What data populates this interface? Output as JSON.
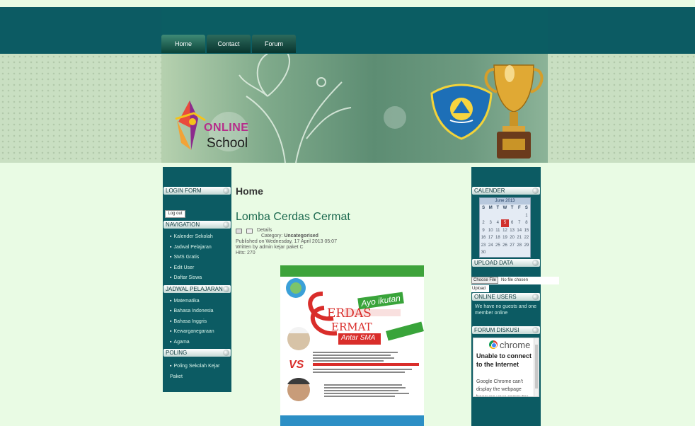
{
  "nav": {
    "tabs": [
      "Home",
      "Contact",
      "Forum"
    ]
  },
  "logo": {
    "online": "ONLINE",
    "school": "School"
  },
  "left": {
    "login": {
      "header": "LOGIN FORM",
      "logout": "Log out"
    },
    "navigation": {
      "header": "NAVIGATION",
      "items": [
        "Kalender Sekolah",
        "Jadwal Pelajaran",
        "SMS Gratis",
        "Edit User",
        "Daftar Siswa"
      ]
    },
    "jadwal": {
      "header": "JADWAL PELAJARAN",
      "items": [
        "Matematika",
        "Bahasa Indonesia",
        "Bahasa Inggris",
        "Kewarganegaraan",
        "Agama"
      ]
    },
    "poling": {
      "header": "POLING",
      "items": [
        "Poling Sekolah Kejar Paket"
      ]
    }
  },
  "main": {
    "page_title": "Home",
    "article_title": "Lomba Cerdas Cermat",
    "details": "Details",
    "category_label": "Category:",
    "category": "Uncategorised",
    "published": "Published on Wednesday, 17 April 2013 05:07",
    "written": "Written by admin kejar paket C",
    "hits": "Hits: 270"
  },
  "poster": {
    "ayo": "Ayo ikutan",
    "cerdas": "ERDAS",
    "cermat": "ERMAT",
    "antar": "Antar SMA",
    "vs": "VS"
  },
  "right": {
    "calendar": {
      "header": "CALENDER",
      "month": "June 2013",
      "days": [
        "S",
        "M",
        "T",
        "W",
        "T",
        "F",
        "S"
      ],
      "today": 5
    },
    "upload": {
      "header": "UPLOAD DATA",
      "choose": "Choose File",
      "nofile": "No file chosen",
      "upload": "Upload"
    },
    "online_users": {
      "header": "ONLINE USERS",
      "text": "We have no guests and one member online"
    },
    "forum": {
      "header": "FORUM DISKUSI",
      "chrome_word": "chrome",
      "title": "Unable to connect to the Internet",
      "body": "Google Chrome can't display the webpage because your computer isn't connected to the Internet."
    }
  },
  "colors": {
    "teal": "#0c5b63",
    "page_bg": "#e9fbe4",
    "link_green": "#1d6a50",
    "today": "#d0312d"
  }
}
